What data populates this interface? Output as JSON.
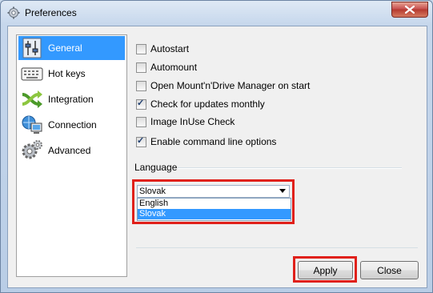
{
  "window": {
    "title": "Preferences"
  },
  "sidebar": {
    "items": [
      {
        "label": "General",
        "icon": "sliders-icon",
        "active": true
      },
      {
        "label": "Hot keys",
        "icon": "keyboard-icon",
        "active": false
      },
      {
        "label": "Integration",
        "icon": "shuffle-icon",
        "active": false
      },
      {
        "label": "Connection",
        "icon": "network-icon",
        "active": false
      },
      {
        "label": "Advanced",
        "icon": "gears-icon",
        "active": false
      }
    ]
  },
  "options": [
    {
      "label": "Autostart",
      "checked": false
    },
    {
      "label": "Automount",
      "checked": false
    },
    {
      "label": "Open Mount'n'Drive Manager on start",
      "checked": false
    },
    {
      "label": "Check for updates monthly",
      "checked": true
    },
    {
      "label": "Image InUse Check",
      "checked": false
    },
    {
      "label": "Enable command line options",
      "checked": true
    }
  ],
  "language": {
    "label": "Language",
    "selected": "Slovak",
    "options": [
      "English",
      "Slovak"
    ]
  },
  "buttons": {
    "apply": "Apply",
    "close": "Close"
  },
  "colors": {
    "accent": "#3399ff",
    "highlight": "#e0201a"
  }
}
